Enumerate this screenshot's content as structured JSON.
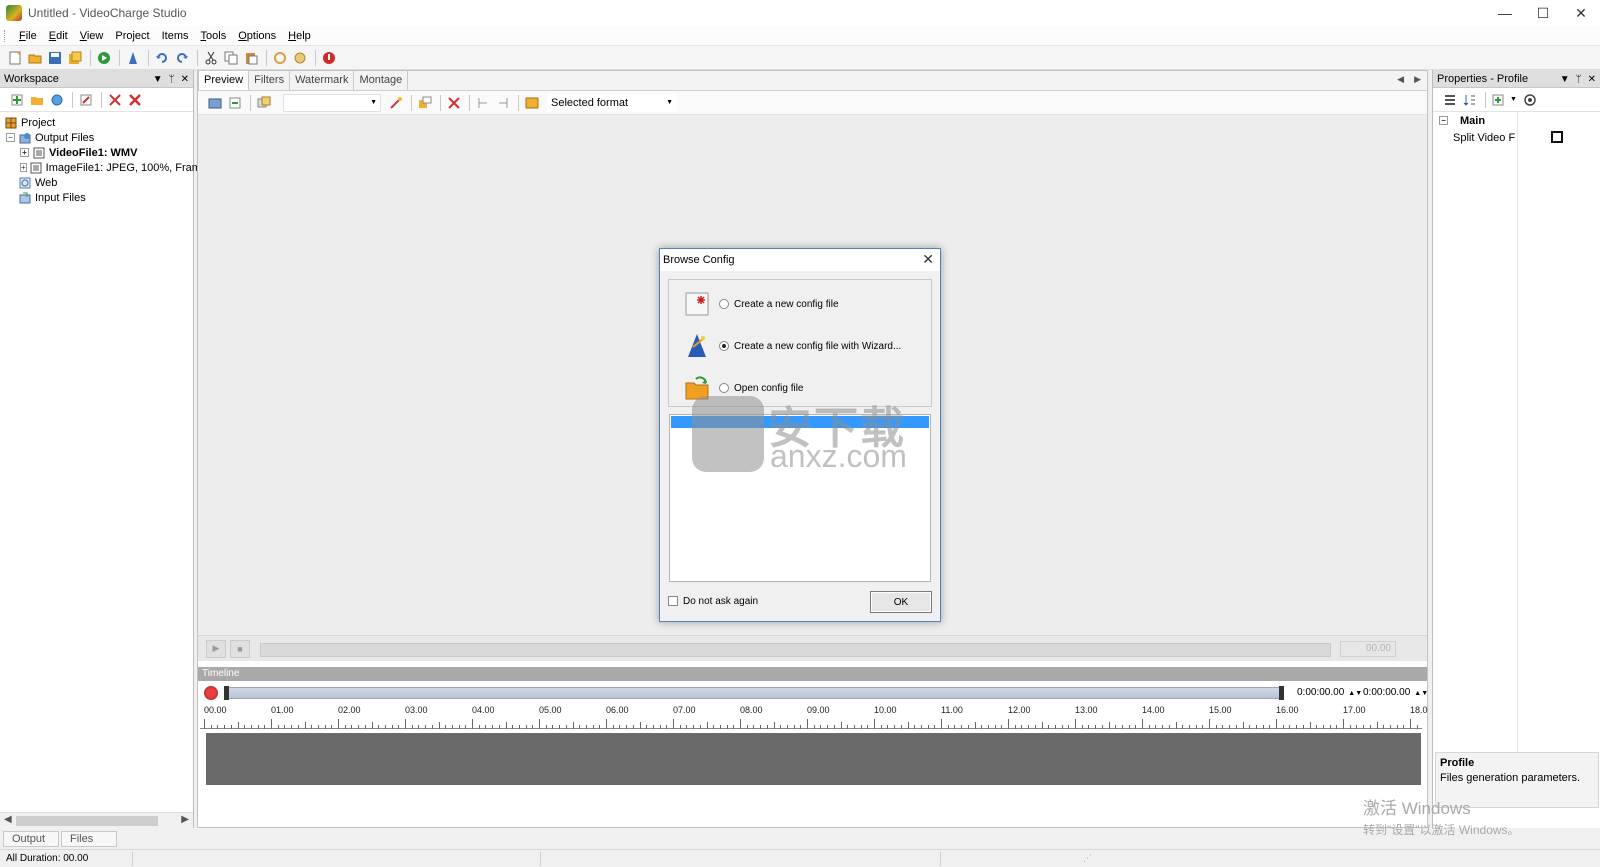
{
  "window": {
    "title": "Untitled - VideoCharge Studio",
    "minimize": "—",
    "maximize": "☐",
    "close": "✕"
  },
  "menu": [
    {
      "label": "File",
      "u": "F",
      "rest": "ile"
    },
    {
      "label": "Edit",
      "u": "E",
      "rest": "dit"
    },
    {
      "label": "View",
      "u": "V",
      "rest": "iew"
    },
    {
      "label": "Project",
      "u": "",
      "rest": "Project"
    },
    {
      "label": "Items",
      "u": "",
      "rest": "Items"
    },
    {
      "label": "Tools",
      "u": "T",
      "rest": "ools"
    },
    {
      "label": "Options",
      "u": "O",
      "rest": "ptions"
    },
    {
      "label": "Help",
      "u": "H",
      "rest": "elp"
    }
  ],
  "workspace": {
    "title": "Workspace",
    "tree": {
      "project": "Project",
      "output_files": "Output Files",
      "video_file": "VideoFile1: WMV",
      "image_file": "ImageFile1: JPEG, 100%, Fram",
      "web": "Web",
      "input_files": "Input Files"
    }
  },
  "editor": {
    "tabs": [
      "Preview",
      "Filters",
      "Watermark",
      "Montage"
    ],
    "active_tab": "Preview",
    "format_combo": "Selected format",
    "player_time": "00.00",
    "timeline": {
      "title": "Timeline",
      "start_time": "0:00:00.00",
      "end_time": "0:00:00.00",
      "ruler_labels": [
        "00.00",
        "01.00",
        "02.00",
        "03.00",
        "04.00",
        "05.00",
        "06.00",
        "07.00",
        "08.00",
        "09.00",
        "10.00",
        "11.00",
        "12.00",
        "13.00",
        "14.00",
        "15.00",
        "16.00",
        "17.00",
        "18.0"
      ]
    }
  },
  "properties": {
    "title": "Properties - Profile",
    "section": "Main",
    "row_label": "Split Video F",
    "desc_title": "Profile",
    "desc_text": "Files generation parameters."
  },
  "dialog": {
    "title": "Browse Config",
    "options": [
      {
        "label": "Create a new config file",
        "selected": false
      },
      {
        "label": "Create a new config file with Wizard...",
        "selected": true
      },
      {
        "label": "Open config file",
        "selected": false
      }
    ],
    "do_not_ask": "Do not ask again",
    "ok": "OK"
  },
  "bottom_tabs": [
    "Output",
    "Files"
  ],
  "status": {
    "duration": "All Duration: 00.00"
  },
  "watermarks": {
    "site_cn": "安下载",
    "site_en": "anxz.com",
    "activate_line1": "激活 Windows",
    "activate_line2": "转到\"设置\"以激活 Windows。"
  }
}
